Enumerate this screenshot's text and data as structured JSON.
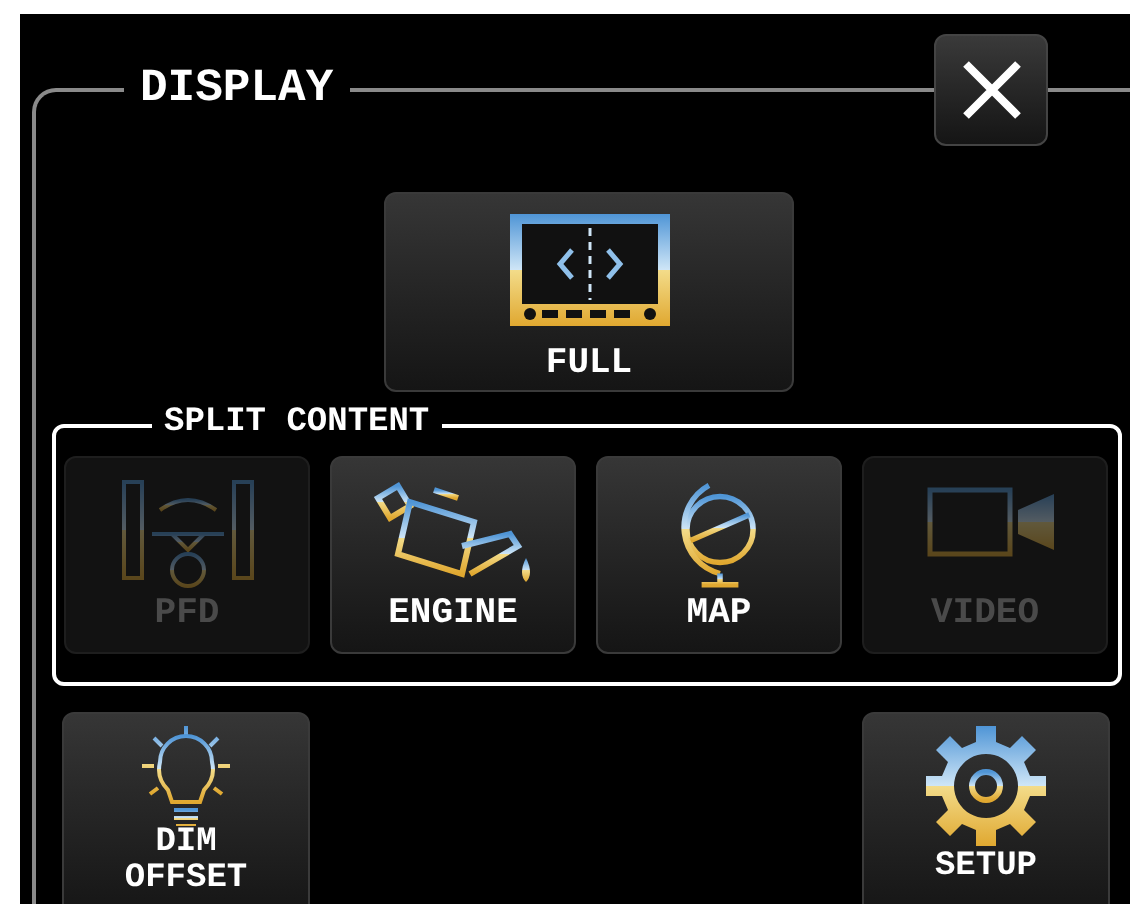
{
  "title": "DISPLAY",
  "full_button": {
    "label": "FULL",
    "kind": "full"
  },
  "split_content": {
    "title": "SPLIT CONTENT",
    "buttons": [
      {
        "label": "PFD",
        "kind": "pfd",
        "disabled": true
      },
      {
        "label": "ENGINE",
        "kind": "engine",
        "disabled": false
      },
      {
        "label": "MAP",
        "kind": "map",
        "disabled": false
      },
      {
        "label": "VIDEO",
        "kind": "video",
        "disabled": true
      }
    ]
  },
  "bottom_buttons": [
    {
      "label": "DIM OFFSET",
      "kind": "dim"
    },
    {
      "label": "SETUP",
      "kind": "setup"
    }
  ]
}
